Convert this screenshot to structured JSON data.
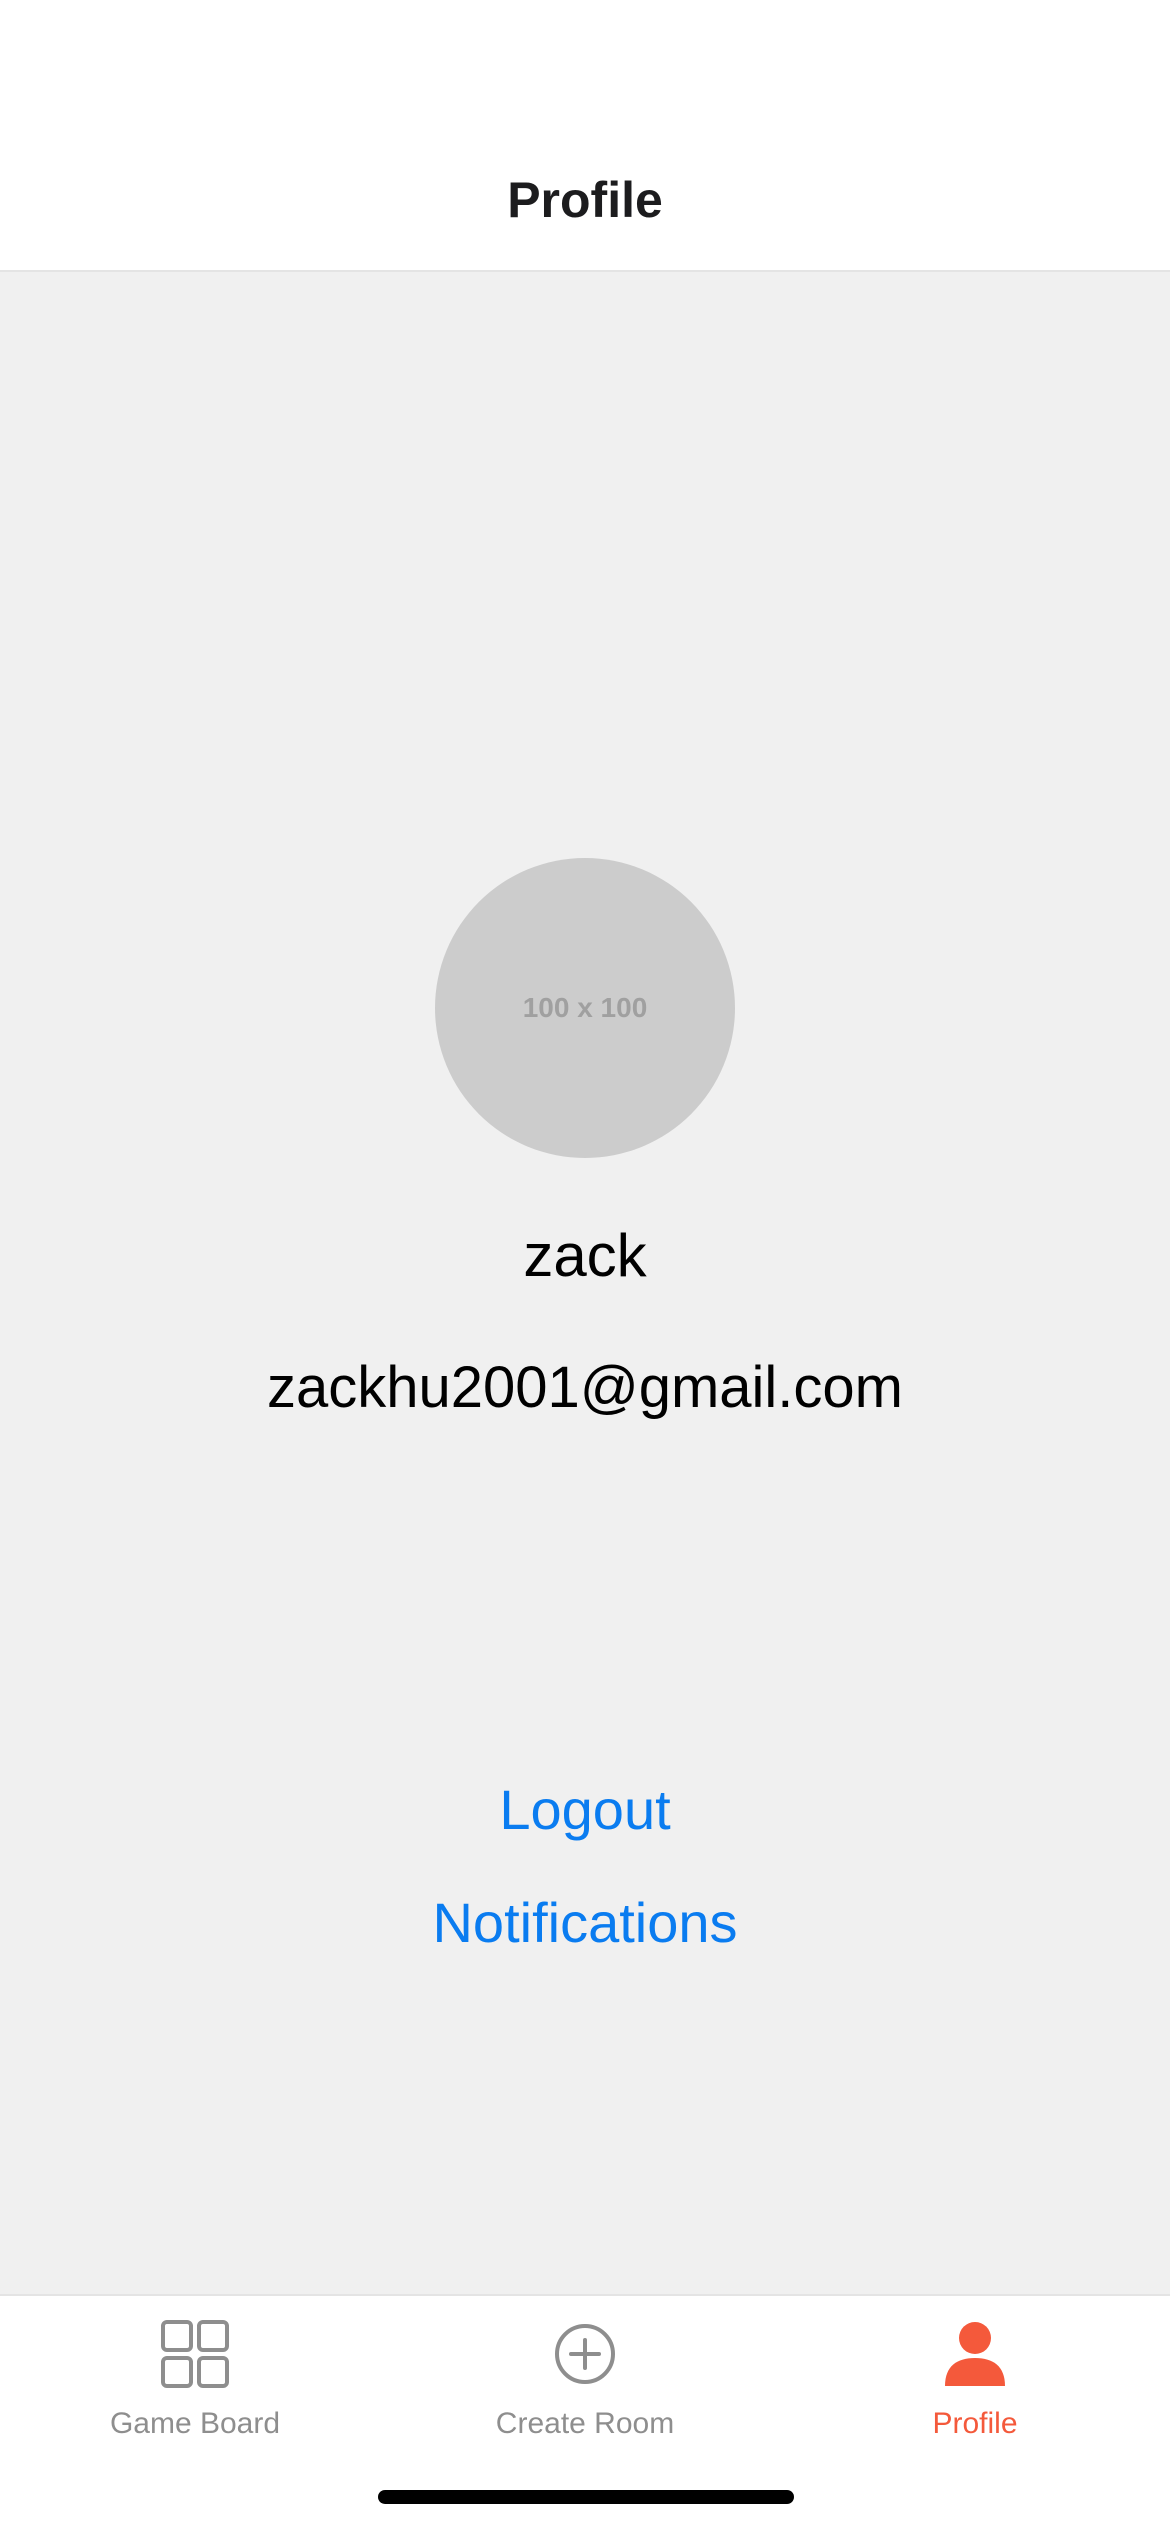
{
  "header": {
    "title": "Profile"
  },
  "profile": {
    "avatar_placeholder": "100 x 100",
    "username": "zack",
    "email": "zackhu2001@gmail.com"
  },
  "actions": {
    "logout_label": "Logout",
    "notifications_label": "Notifications"
  },
  "tabs": [
    {
      "label": "Game Board",
      "icon": "grid-icon",
      "active": false
    },
    {
      "label": "Create Room",
      "icon": "plus-circle-icon",
      "active": false
    },
    {
      "label": "Profile",
      "icon": "person-icon",
      "active": true
    }
  ],
  "colors": {
    "accent": "#f4593b",
    "link": "#0a7cf0",
    "inactive": "#8e8e8e",
    "background": "#f0f0f0"
  }
}
